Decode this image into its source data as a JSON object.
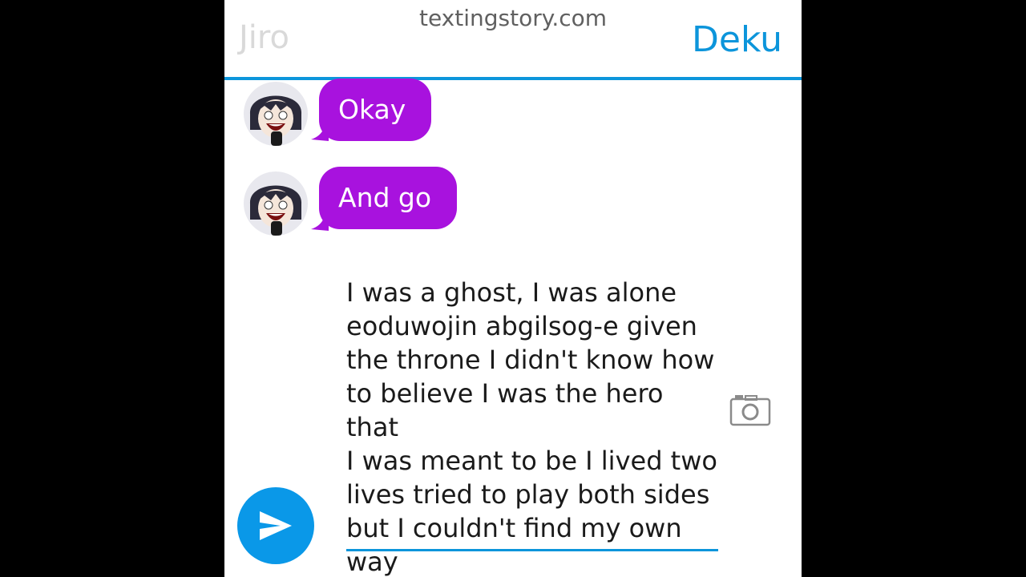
{
  "header": {
    "site": "textingstory.com",
    "left_contact": "Jiro",
    "right_contact": "Deku"
  },
  "messages": [
    {
      "text": "Okay",
      "sender": "Jiro"
    },
    {
      "text": "And go",
      "sender": "Jiro"
    }
  ],
  "composer": {
    "text": "I was a ghost, I was alone\neoduwojin abgilsog-e given\nthe throne I didn't know how\nto believe I was the hero that\nI was meant to be I lived two\nlives tried to play both sides\nbut I couldn't find my own\nway"
  },
  "icons": {
    "camera": "camera-icon",
    "send": "send-icon"
  },
  "colors": {
    "accent": "#0c95db",
    "bubble": "#a812de",
    "send_button": "#0a98e8"
  }
}
